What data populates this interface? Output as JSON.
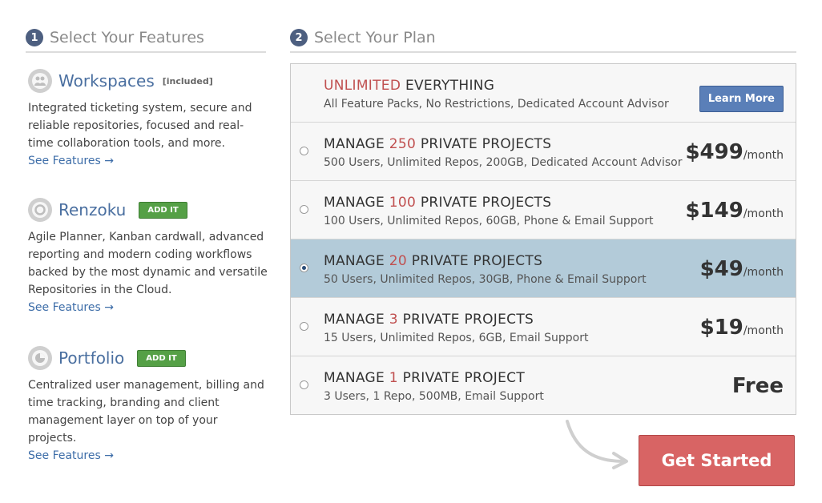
{
  "features": {
    "step_number": "1",
    "step_title": "Select Your Features",
    "items": [
      {
        "name": "Workspaces",
        "tag": "[included]",
        "description": "Integrated ticketing system, secure and reliable repositories, focused and real-time collaboration tools, and more.",
        "link": "See Features →",
        "icon": "people-icon"
      },
      {
        "name": "Renzoku",
        "button": "ADD IT",
        "description": "Agile Planner, Kanban cardwall, advanced reporting and modern coding workflows backed by the most dynamic and versatile Repositories in the Cloud.",
        "link": "See Features →",
        "icon": "cycle-icon"
      },
      {
        "name": "Portfolio",
        "button": "ADD IT",
        "description": "Centralized user management, billing and time tracking, branding and client management layer on top of your projects.",
        "link": "See Features →",
        "icon": "pie-chart-icon"
      }
    ]
  },
  "plans": {
    "step_number": "2",
    "step_title": "Select Your Plan",
    "items": [
      {
        "title_prefix": "",
        "title_highlight": "UNLIMITED",
        "title_suffix": " EVERYTHING",
        "subtitle": "All Feature Packs, No Restrictions, Dedicated Account Advisor",
        "button": "Learn More"
      },
      {
        "title_prefix": "MANAGE ",
        "title_highlight": "250",
        "title_suffix": " PRIVATE PROJECTS",
        "subtitle": "500 Users, Unlimited Repos, 200GB, Dedicated Account Advisor",
        "price": "$499",
        "per": "/month",
        "selected": false
      },
      {
        "title_prefix": "MANAGE ",
        "title_highlight": "100",
        "title_suffix": " PRIVATE PROJECTS",
        "subtitle": "100 Users, Unlimited Repos, 60GB, Phone & Email Support",
        "price": "$149",
        "per": "/month",
        "selected": false
      },
      {
        "title_prefix": "MANAGE ",
        "title_highlight": "20",
        "title_suffix": " PRIVATE PROJECTS",
        "subtitle": "50 Users, Unlimited Repos, 30GB, Phone & Email Support",
        "price": "$49",
        "per": "/month",
        "selected": true
      },
      {
        "title_prefix": "MANAGE ",
        "title_highlight": "3",
        "title_suffix": " PRIVATE PROJECTS",
        "subtitle": "15 Users, Unlimited Repos, 6GB, Email Support",
        "price": "$19",
        "per": "/month",
        "selected": false
      },
      {
        "title_prefix": "MANAGE ",
        "title_highlight": "1",
        "title_suffix": " PRIVATE PROJECT",
        "subtitle": "3 Users, 1 Repo, 500MB, Email Support",
        "price": "Free",
        "per": "",
        "selected": false
      }
    ]
  },
  "cta": {
    "label": "Get Started"
  },
  "colors": {
    "accent_blue": "#4a6fa0",
    "highlight_red": "#c05050",
    "selected_row": "#b3cbd9",
    "cta": "#d86464",
    "add_green": "#55a046"
  }
}
